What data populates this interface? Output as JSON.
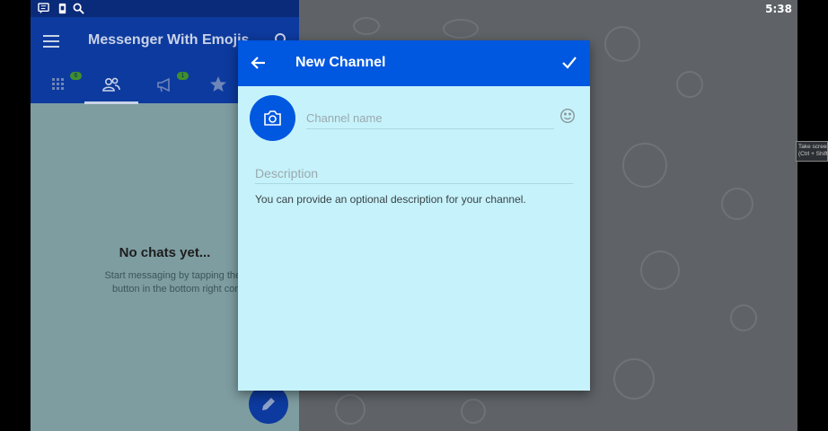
{
  "status_bar": {
    "time": "5:38",
    "icons": [
      "message-icon",
      "sim-icon",
      "search-icon"
    ]
  },
  "left_panel": {
    "app_title": "Messenger With Emojis",
    "tabs": [
      {
        "icon": "grid-icon",
        "badge": "6"
      },
      {
        "icon": "contacts-icon",
        "badge": ""
      },
      {
        "icon": "megaphone-icon",
        "badge": "1"
      },
      {
        "icon": "star-icon",
        "badge": ""
      }
    ],
    "empty_title": "No chats yet...",
    "empty_line1": "Start messaging by tapping the pen",
    "empty_line2": "button in the bottom right corner"
  },
  "dialog": {
    "title": "New Channel",
    "name_placeholder": "Channel name",
    "description_placeholder": "Description",
    "helper_text": "You can provide an optional description for your channel."
  },
  "tooltip": {
    "line1": "Take screenshot",
    "line2": "(Ctrl + Shift + S)"
  },
  "colors": {
    "header_blue": "#0057e0",
    "dialog_bg": "#c6f2fb",
    "dim_overlay": "#5f6368"
  }
}
